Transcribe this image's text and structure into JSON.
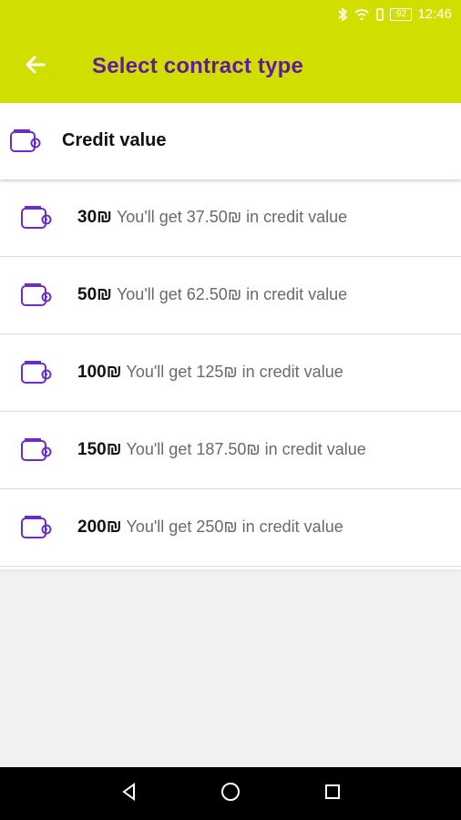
{
  "colors": {
    "app_bar": "#d0df00",
    "title": "#5f1aa2",
    "icon_purple": "#6b2ec5",
    "background": "#f1f1f1",
    "nav_bar": "#000000"
  },
  "status_bar": {
    "battery_level": "92",
    "time": "12:46",
    "icons": [
      "bluetooth-icon",
      "wifi-icon",
      "vibrate-icon",
      "battery-icon"
    ]
  },
  "app_bar": {
    "back_icon": "arrow-left-icon",
    "title": "Select contract type"
  },
  "header": {
    "icon": "wallet-icon",
    "label": "Credit value"
  },
  "options": [
    {
      "amount": "30₪",
      "description": "You'll get 37.50₪ in credit value",
      "icon": "wallet-icon"
    },
    {
      "amount": "50₪",
      "description": "You'll get 62.50₪ in credit value",
      "icon": "wallet-icon"
    },
    {
      "amount": "100₪",
      "description": "You'll get 125₪ in credit value",
      "icon": "wallet-icon"
    },
    {
      "amount": "150₪",
      "description": "You'll get 187.50₪ in credit value",
      "icon": "wallet-icon"
    },
    {
      "amount": "200₪",
      "description": "You'll get 250₪ in credit value",
      "icon": "wallet-icon"
    }
  ],
  "nav_bar": {
    "buttons": [
      "back-triangle-icon",
      "home-circle-icon",
      "recents-square-icon"
    ]
  }
}
